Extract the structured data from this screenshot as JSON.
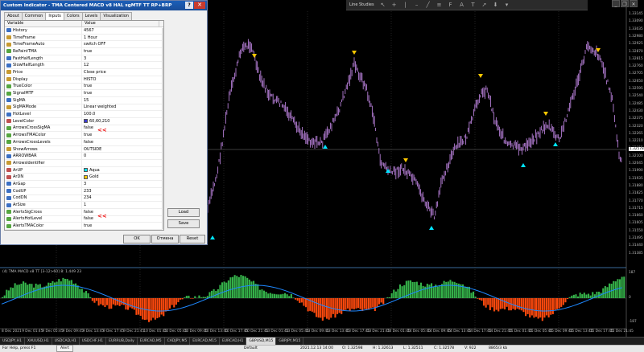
{
  "dialog": {
    "title": "Custom Indicator - TMA Centered MACD v8 HAL sgMTF TT RP+BRP",
    "help_label": "?",
    "close_label": "✕",
    "tabs": [
      "About",
      "Common",
      "Inputs",
      "Colors",
      "Levels",
      "Visualization"
    ],
    "active_tab": "Inputs",
    "columns": [
      "Variable",
      "Value"
    ],
    "rows": [
      {
        "name": "History",
        "value": "4567",
        "type": "int"
      },
      {
        "name": "TimeFrame",
        "value": "1 Hour",
        "type": "str"
      },
      {
        "name": "TimeFrameAuto",
        "value": "switch OFF",
        "type": "str"
      },
      {
        "name": "RePaintTMA",
        "value": "true",
        "type": "bool"
      },
      {
        "name": "FastHalfLength",
        "value": "3",
        "type": "int"
      },
      {
        "name": "SlowHalfLength",
        "value": "12",
        "type": "int"
      },
      {
        "name": "Price",
        "value": "Close price",
        "type": "str"
      },
      {
        "name": "Display",
        "value": "HISTO",
        "type": "str"
      },
      {
        "name": "TrueColor",
        "value": "true",
        "type": "bool"
      },
      {
        "name": "SignalMTF",
        "value": "true",
        "type": "bool"
      },
      {
        "name": "SigMA",
        "value": "15",
        "type": "int"
      },
      {
        "name": "SigMAMode",
        "value": "Linear weighted",
        "type": "str"
      },
      {
        "name": "HotLevel",
        "value": "100.0",
        "type": "int"
      },
      {
        "name": "LevelColor",
        "value": "60,60,210",
        "type": "col",
        "swatch": "#3c3cd2"
      },
      {
        "name": "ArrowsCrossSigMA",
        "value": "false",
        "type": "bool"
      },
      {
        "name": "ArrowsTMAColor",
        "value": "true",
        "type": "bool"
      },
      {
        "name": "ArrowsCrossLevels",
        "value": "false",
        "type": "bool"
      },
      {
        "name": "ShowArrows",
        "value": "OUTSIDE",
        "type": "str"
      },
      {
        "name": "ARROWBAR",
        "value": "0",
        "type": "int"
      },
      {
        "name": "ArrowsIdentifier",
        "value": "",
        "type": "str"
      },
      {
        "name": "ArUP",
        "value": "Aqua",
        "type": "col",
        "swatch": "#00e5ff"
      },
      {
        "name": "ArDN",
        "value": "Gold",
        "type": "col",
        "swatch": "#ffc800"
      },
      {
        "name": "ArGap",
        "value": "3",
        "type": "int"
      },
      {
        "name": "CodUP",
        "value": "233",
        "type": "int"
      },
      {
        "name": "CodDN",
        "value": "234",
        "type": "int"
      },
      {
        "name": "ArSize",
        "value": "1",
        "type": "int"
      },
      {
        "name": "AlertsSigCross",
        "value": "false",
        "type": "bool"
      },
      {
        "name": "AlertsHotLevel",
        "value": "false",
        "type": "bool"
      },
      {
        "name": "AlertsTMAColor",
        "value": "true",
        "type": "bool"
      },
      {
        "name": "SIGNALBAR",
        "value": "1",
        "type": "int"
      }
    ],
    "marker": "<<",
    "buttons": {
      "load": "Load",
      "save": "Save",
      "ok": "OK",
      "cancel": "Отмена",
      "reset": "Reset"
    }
  },
  "toolbar": {
    "title": "Line Studies"
  },
  "indicator_label": "(4) TMA MACD v8 TT [3-12>60] 8: 1.449 23",
  "price_axis": [
    "1.33145",
    "1.33090",
    "1.33035",
    "1.32980",
    "1.32925",
    "1.32870",
    "1.32815",
    "1.32760",
    "1.32705",
    "1.32650",
    "1.32595",
    "1.32540",
    "1.32485",
    "1.32430",
    "1.32375",
    "1.32320",
    "1.32265",
    "1.32210",
    "1.32155",
    "1.32100",
    "1.32045",
    "1.31990",
    "1.31935",
    "1.31880",
    "1.31825",
    "1.31770",
    "1.31715",
    "1.31660",
    "1.31605",
    "1.31550",
    "1.31495",
    "1.31440",
    "1.31385"
  ],
  "current_price": "1.32578",
  "indicator_axis": [
    "187",
    "0",
    "-187"
  ],
  "time_axis": [
    "8 Dec 2021",
    "9 Dec 01:45",
    "9 Dec 05:45",
    "9 Dec 09:45",
    "9 Dec 13:45",
    "9 Dec 17:45",
    "9 Dec 21:45",
    "10 Dec 01:45",
    "10 Dec 05:45",
    "10 Dec 09:45",
    "10 Dec 13:45",
    "10 Dec 17:45",
    "10 Dec 21:45",
    "13 Dec 01:45",
    "13 Dec 05:45",
    "13 Dec 09:45",
    "13 Dec 13:45",
    "13 Dec 17:45",
    "13 Dec 21:45",
    "14 Dec 01:45",
    "14 Dec 05:45",
    "14 Dec 09:45",
    "14 Dec 13:45",
    "14 Dec 17:45",
    "14 Dec 21:45",
    "15 Dec 01:45",
    "15 Dec 05:45",
    "15 Dec 09:45",
    "15 Dec 13:45",
    "15 Dec 17:45",
    "15 Dec 21:45"
  ],
  "symbols": [
    "USDJPY,H1",
    "XAUUSD,H1",
    "USDCAD,H1",
    "USDCHF,H1",
    "EURRUB,Daily",
    "EURCAD,M5",
    "CADJPY,M5",
    "EURCAD,M15",
    "EURCAD,H1",
    "GBPUSD,M15",
    "GBPJPY,M15"
  ],
  "active_symbol": "GBPUSD,M15",
  "status": {
    "help": "For Help, press F1",
    "profile": "Default",
    "datetime": "2021.12.13 14:00",
    "open": "O: 1.32598",
    "high": "H: 1.32613",
    "low": "L: 1.32511",
    "close": "C: 1.32578",
    "volume": "V: 922",
    "traffic": "8865/3 kb"
  },
  "alert_tab": "Alert",
  "colors": {
    "candle": "#b57ed6",
    "signal": "#1e88ff",
    "histo_up": "#35b24a",
    "histo_dn": "#ff4a0e",
    "arrow_up": "#00e5ff",
    "arrow_dn": "#ffc800"
  }
}
